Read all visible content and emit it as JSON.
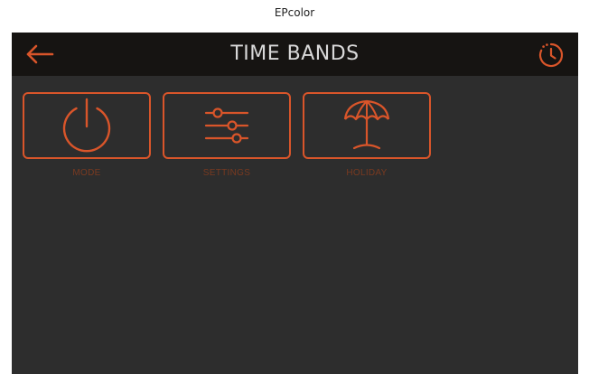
{
  "caption": "EPcolor",
  "header": {
    "title": "TIME BANDS",
    "back_icon": "arrow-left-icon",
    "history_icon": "clock-history-icon"
  },
  "tiles": [
    {
      "label": "MODE",
      "icon": "power-icon"
    },
    {
      "label": "SETTINGS",
      "icon": "sliders-icon"
    },
    {
      "label": "HOLIDAY",
      "icon": "umbrella-icon"
    }
  ],
  "colors": {
    "accent": "#d9552a",
    "background": "#2d2d2d",
    "header": "#161412",
    "title_text": "#d9d9d9",
    "label_text": "#7a3a20"
  }
}
